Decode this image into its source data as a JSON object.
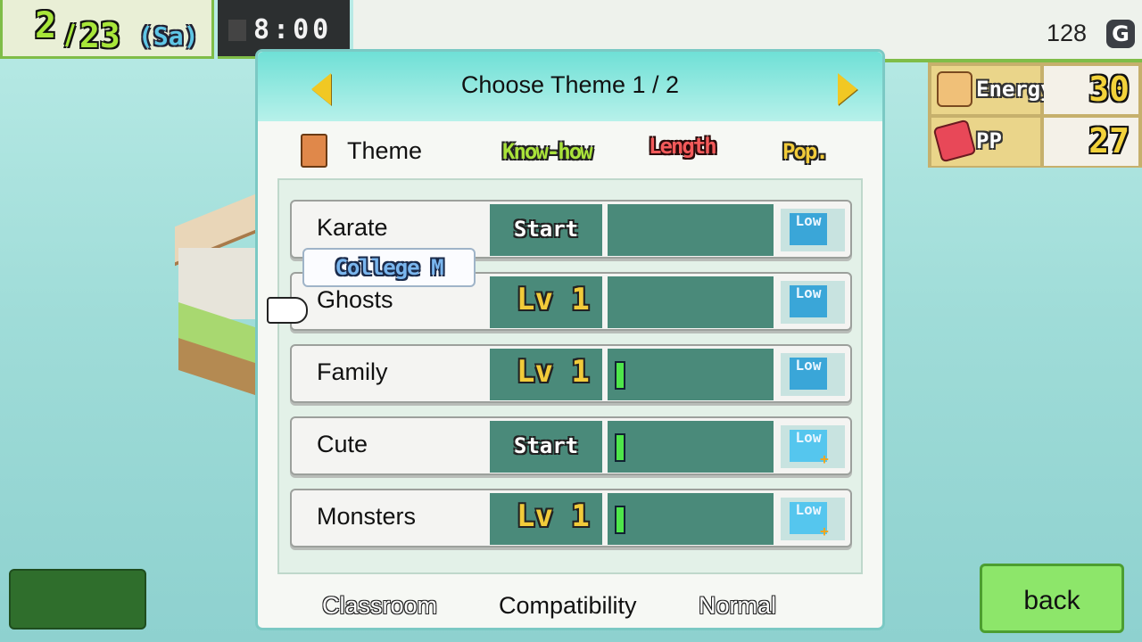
{
  "topbar": {
    "date_month": "2",
    "date_slash": "/",
    "date_day": "23",
    "date_weekday": "(Sa)",
    "clock": "8:00",
    "money": "128",
    "money_icon": "G"
  },
  "stats": {
    "energy_label": "Energy",
    "energy_value": "30",
    "pp_label": "PP",
    "pp_value": "27"
  },
  "dialog": {
    "title": "Choose Theme 1 / 2",
    "prev_icon": "arrow-left-icon",
    "next_icon": "arrow-right-icon",
    "headers": {
      "theme": "Theme",
      "knowhow": "Know-how",
      "length": "Length",
      "popularity": "Pop."
    },
    "tooltip": "College M",
    "rows": [
      {
        "name": "Karate",
        "level": "Start",
        "length_fraction": 0,
        "pop": "Low",
        "pop_plus": false
      },
      {
        "name": "Ghosts",
        "level": "Lv 1",
        "length_fraction": 0,
        "pop": "Low",
        "pop_plus": false
      },
      {
        "name": "Family",
        "level": "Lv 1",
        "length_fraction": 0.07,
        "pop": "Low",
        "pop_plus": false
      },
      {
        "name": "Cute",
        "level": "Start",
        "length_fraction": 0.07,
        "pop": "Low",
        "pop_plus": true
      },
      {
        "name": "Monsters",
        "level": "Lv 1",
        "length_fraction": 0.07,
        "pop": "Low",
        "pop_plus": true
      }
    ],
    "footer": {
      "left": "Classroom",
      "center": "Compatibility",
      "right": "Normal"
    }
  },
  "buttons": {
    "back": "back"
  },
  "colors": {
    "header_teal": "#6fe0d6",
    "row_cell": "#4a8a7a",
    "length_bar": "#4ee64a",
    "back_button": "#8de66a"
  }
}
